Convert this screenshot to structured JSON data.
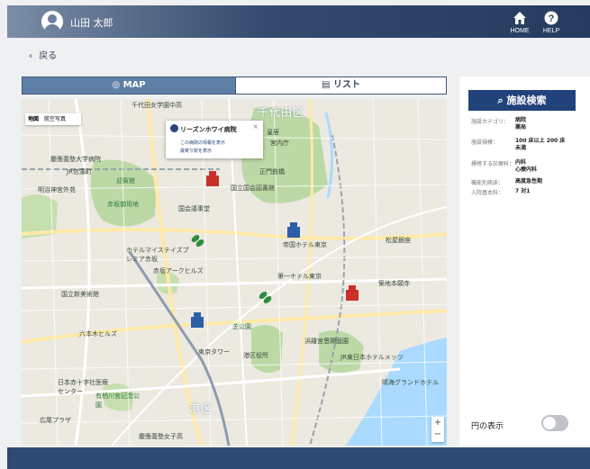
{
  "header": {
    "user_name": "山田 太郎",
    "home_label": "HOME",
    "help_label": "HELP"
  },
  "nav": {
    "back_label": "戻る"
  },
  "tabs": {
    "map_label": "MAP",
    "list_label": "リスト",
    "active": "map"
  },
  "map": {
    "map_type": [
      "地図",
      "航空写真"
    ],
    "popup": {
      "title": "リーズンホワイ病院",
      "link1": "この病院の情報を表示",
      "link2": "最寄り駅を表示"
    },
    "zoom": {
      "in": "+",
      "out": "−"
    },
    "labels": [
      "千代田女学園中高",
      "千代田区",
      "慶應義塾大学病院",
      "JR信濃町",
      "明治神宮外苑",
      "迎賓館",
      "赤坂御用地",
      "皇居",
      "宮内庁",
      "国立国会図書館",
      "国会議事堂",
      "正門鉄橋",
      "帝国ホテル東京",
      "松屋銀座",
      "第一ホテル東京",
      "築地本願寺",
      "ホテルマイステイズプレミア赤坂",
      "赤坂アークヒルズ",
      "国立新美術館",
      "六本木ヒルズ",
      "東京タワー",
      "港区役所",
      "浜離宮恩賜庭園",
      "JR東日本ホテルメッツ",
      "日本赤十字社医療センター",
      "有栖川宮記念公園",
      "広尾プラザ",
      "慶應義塾女子高",
      "港区",
      "芝公園",
      "晴海グランドホテル"
    ]
  },
  "panel": {
    "search_label": "施設検索",
    "filters": [
      {
        "key": "施設カテゴリ：",
        "value": "病院\n薬局"
      },
      {
        "key": "施設規模：",
        "value": "100 床以上 200 床\n未満"
      },
      {
        "key": "標榜する診療科：",
        "value": "内科\n心療内科"
      },
      {
        "key": "機能別病床：",
        "value": "高度急性期"
      },
      {
        "key": "入院基本料：",
        "value": "7 対1"
      }
    ],
    "circle_label": "円の表示",
    "circle_on": false
  },
  "colors": {
    "header_dark": "#263c5f",
    "accent": "#21427a",
    "marker_red": "#c8302a",
    "marker_blue": "#2d5fa8",
    "marker_green": "#2e8b3e"
  }
}
